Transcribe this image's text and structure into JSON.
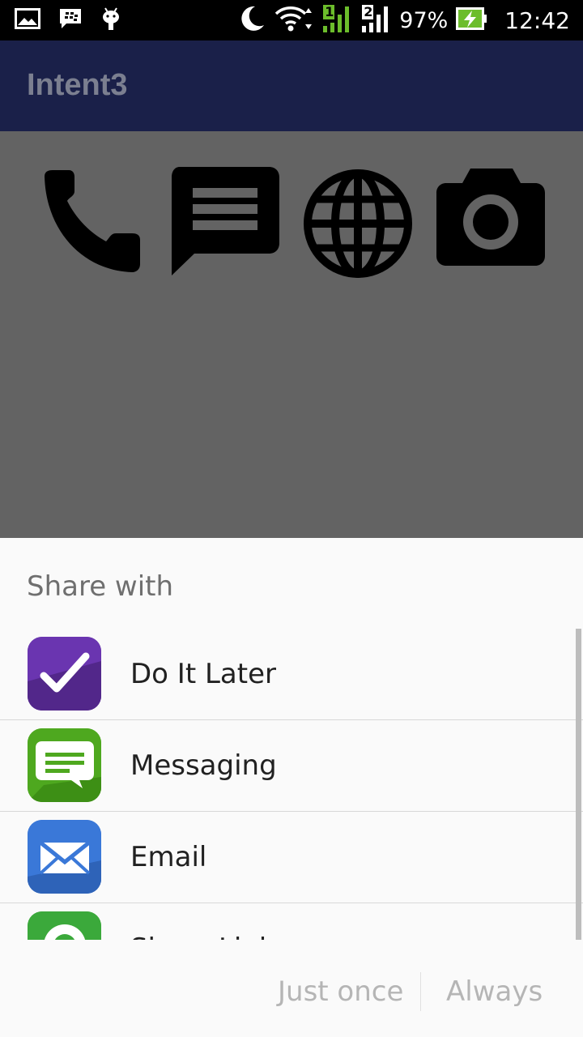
{
  "status_bar": {
    "battery_percent": "97%",
    "time": "12:42",
    "sim1": "1",
    "sim2": "2",
    "icons": [
      "gallery-icon",
      "blackberry-icon",
      "android-debug-icon",
      "moon-icon",
      "wifi-icon",
      "signal-icon",
      "signal-icon",
      "battery-charging-icon"
    ]
  },
  "app_bar": {
    "title": "Intent3"
  },
  "content": {
    "icons": [
      "phone-icon",
      "message-icon",
      "globe-icon",
      "camera-icon"
    ]
  },
  "share_sheet": {
    "title": "Share with",
    "apps": [
      {
        "label": "Do It Later",
        "icon": "do-it-later-icon"
      },
      {
        "label": "Messaging",
        "icon": "messaging-app-icon"
      },
      {
        "label": "Email",
        "icon": "email-app-icon"
      },
      {
        "label": "Share Link",
        "icon": "share-link-app-icon"
      }
    ],
    "buttons": {
      "just_once": "Just once",
      "always": "Always"
    }
  },
  "colors": {
    "app_bar_dimmed": "#1a2049",
    "scrim": "#636363",
    "sheet_bg": "#fafafa",
    "battery_green": "#6cbd2b"
  }
}
